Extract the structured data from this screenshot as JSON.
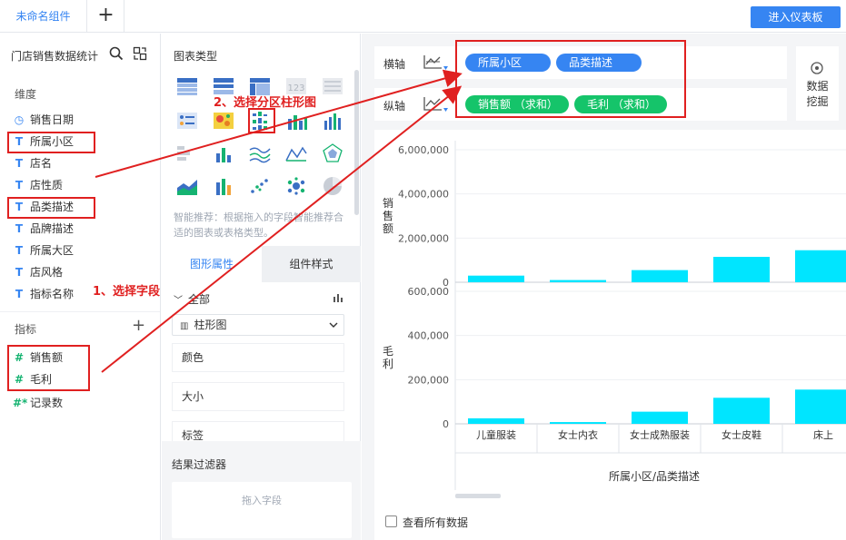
{
  "topbar": {
    "tab_label": "未命名组件",
    "add_tab": "+",
    "enter_dashboard": "进入仪表板"
  },
  "left": {
    "dataset_title": "门店销售数据统计",
    "dimension_label": "维度",
    "dimensions": [
      {
        "icon": "clock-icon",
        "label": "销售日期"
      },
      {
        "icon": "text-field-icon",
        "label": "所属小区"
      },
      {
        "icon": "text-field-icon",
        "label": "店名"
      },
      {
        "icon": "text-field-icon",
        "label": "店性质"
      },
      {
        "icon": "text-field-icon",
        "label": "品类描述"
      },
      {
        "icon": "text-field-icon",
        "label": "品牌描述"
      },
      {
        "icon": "text-field-icon",
        "label": "所属大区"
      },
      {
        "icon": "text-field-icon",
        "label": "店风格"
      },
      {
        "icon": "text-field-icon",
        "label": "指标名称"
      }
    ],
    "measure_label": "指标",
    "measures": [
      {
        "icon": "number-field-icon",
        "label": "销售额"
      },
      {
        "icon": "number-field-icon",
        "label": "毛利"
      },
      {
        "icon": "record-count-icon",
        "label": "记录数"
      }
    ]
  },
  "middle": {
    "chart_type_title": "图表类型",
    "smart_recommend": "智能推荐：根据拖入的字段智能推荐合适的图表或表格类型。",
    "tab_graph_props": "图形属性",
    "tab_component_style": "组件样式",
    "all_label": "全部",
    "chart_select": "柱形图",
    "props": [
      "颜色",
      "大小",
      "标签"
    ],
    "filter_title": "结果过滤器",
    "filter_placeholder": "拖入字段"
  },
  "right": {
    "x_axis_label": "横轴",
    "y_axis_label": "纵轴",
    "x_pills": [
      "所属小区",
      "品类描述"
    ],
    "y_pills": [
      "销售额  （求和）",
      "毛利  （求和）"
    ],
    "mining_label_1": "数据",
    "mining_label_2": "挖掘",
    "view_all_data": "查看所有数据"
  },
  "annotations": {
    "step1": "1、选择字段",
    "step2": "2、选择分区柱形图"
  },
  "colors": {
    "accent": "#3685f2",
    "green": "#15c46a",
    "bar": "#00e5ff",
    "annotation": "#e02020"
  },
  "chart_data": {
    "type": "bar",
    "categories": [
      "儿童服装",
      "女士内衣",
      "女士成熟服装",
      "女士皮鞋",
      "床上用品"
    ],
    "category_labels_visible": [
      "儿童服装",
      "女士内衣",
      "女士成熟服装",
      "女士皮鞋",
      "床上"
    ],
    "xlabel": "所属小区/品类描述",
    "series": [
      {
        "name": "销售额",
        "ylabel": "销售额",
        "values": [
          300000,
          100000,
          550000,
          1150000,
          1450000
        ],
        "ylim": [
          0,
          6000000
        ],
        "ticks": [
          "0",
          "2,000,000",
          "4,000,000",
          "6,000,000"
        ]
      },
      {
        "name": "毛利",
        "ylabel": "毛利",
        "values": [
          25000,
          8000,
          55000,
          118000,
          155000
        ],
        "ylim": [
          0,
          600000
        ],
        "ticks": [
          "0",
          "200,000",
          "400,000",
          "600,000"
        ]
      }
    ],
    "grid": true
  }
}
